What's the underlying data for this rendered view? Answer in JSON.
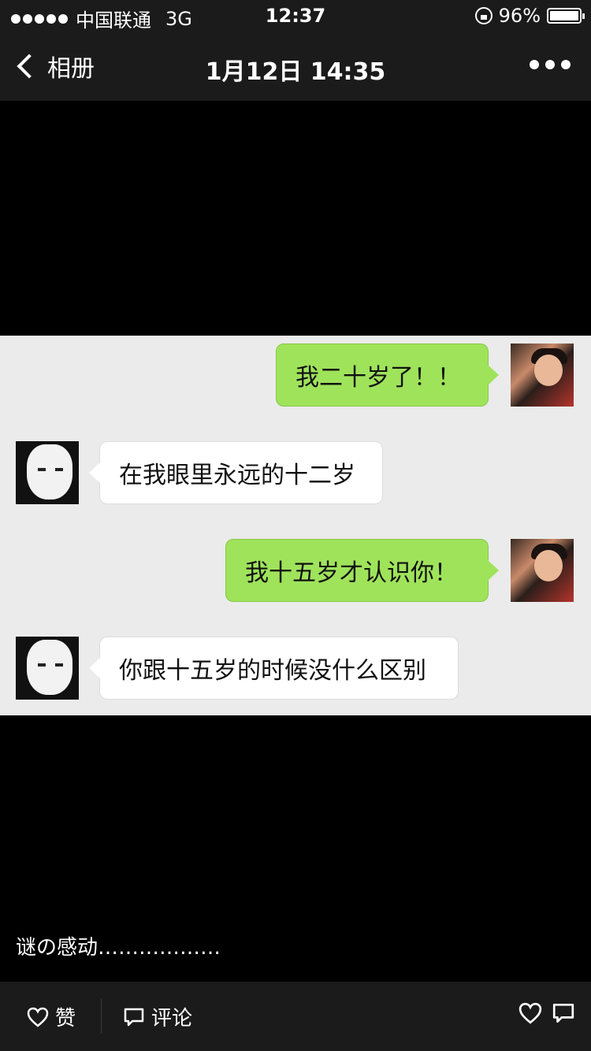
{
  "status_bar": {
    "carrier": "中国联通",
    "network": "3G",
    "time": "12:37",
    "battery": "96%",
    "battery_level": 0.96
  },
  "nav": {
    "back_label": "相册",
    "title": "1月12日 14:35"
  },
  "chat_photo": {
    "messages": [
      {
        "side": "right",
        "text": "我二十岁了！！"
      },
      {
        "side": "left",
        "text": "在我眼里永远的十二岁"
      },
      {
        "side": "right",
        "text": "我十五岁才认识你！"
      },
      {
        "side": "left",
        "text": "你跟十五岁的时候没什么区别"
      }
    ]
  },
  "caption": "谜の感动………………",
  "toolbar": {
    "like_label": "赞",
    "comment_label": "评论"
  },
  "colors": {
    "bar_bg": "#1b1b1b",
    "self_bubble": "#9fe35b",
    "other_bubble": "#ffffff",
    "chat_bg": "#ebebeb"
  }
}
